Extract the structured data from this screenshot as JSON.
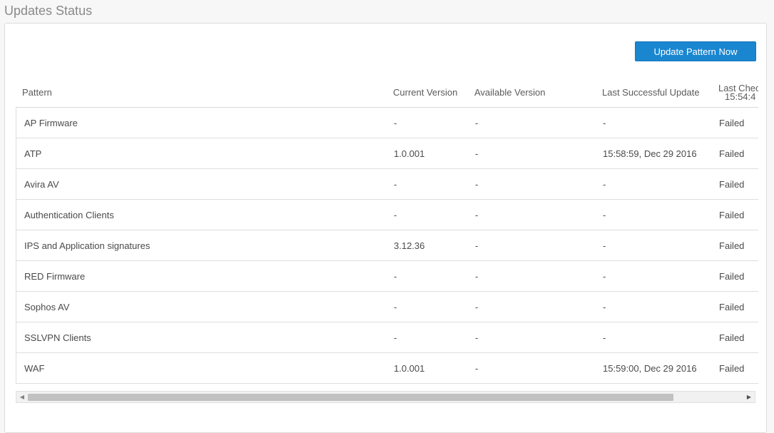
{
  "page": {
    "title": "Updates Status"
  },
  "toolbar": {
    "update_label": "Update Pattern Now"
  },
  "table": {
    "headers": {
      "pattern": "Pattern",
      "current": "Current Version",
      "available": "Available Version",
      "last_success": "Last Successful Update",
      "last_check_line1": "Last Chec",
      "last_check_line2": "15:54:4"
    },
    "rows": [
      {
        "pattern": "AP Firmware",
        "current": "-",
        "available": "-",
        "last_success": "-",
        "status": "Failed"
      },
      {
        "pattern": "ATP",
        "current": "1.0.001",
        "available": "-",
        "last_success": "15:58:59, Dec 29 2016",
        "status": "Failed"
      },
      {
        "pattern": "Avira AV",
        "current": "-",
        "available": "-",
        "last_success": "-",
        "status": "Failed"
      },
      {
        "pattern": "Authentication Clients",
        "current": "-",
        "available": "-",
        "last_success": "-",
        "status": "Failed"
      },
      {
        "pattern": "IPS and Application signatures",
        "current": "3.12.36",
        "available": "-",
        "last_success": "-",
        "status": "Failed"
      },
      {
        "pattern": "RED Firmware",
        "current": "-",
        "available": "-",
        "last_success": "-",
        "status": "Failed"
      },
      {
        "pattern": "Sophos AV",
        "current": "-",
        "available": "-",
        "last_success": "-",
        "status": "Failed"
      },
      {
        "pattern": "SSLVPN Clients",
        "current": "-",
        "available": "-",
        "last_success": "-",
        "status": "Failed"
      },
      {
        "pattern": "WAF",
        "current": "1.0.001",
        "available": "-",
        "last_success": "15:59:00, Dec 29 2016",
        "status": "Failed"
      }
    ]
  },
  "scrollbar": {
    "left_arrow": "◀",
    "right_arrow": "▶"
  },
  "colors": {
    "accent": "#1a86d0",
    "title": "#8a8a8a",
    "border": "#dcdcdc"
  }
}
